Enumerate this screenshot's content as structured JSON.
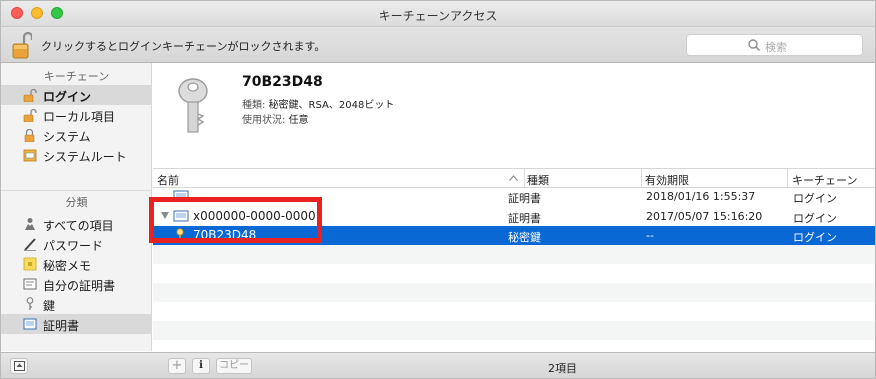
{
  "window": {
    "title": "キーチェーンアクセス"
  },
  "toolbar": {
    "lock_text": "クリックするとログインキーチェーンがロックされます。",
    "search_placeholder": "検索"
  },
  "sidebar": {
    "keychains_heading": "キーチェーン",
    "keychains": [
      {
        "label": "ログイン",
        "icon": "padlock-open-icon",
        "selected": true
      },
      {
        "label": "ローカル項目",
        "icon": "padlock-open-icon",
        "selected": false
      },
      {
        "label": "システム",
        "icon": "padlock-closed-icon",
        "selected": false
      },
      {
        "label": "システムルート",
        "icon": "certificate-folder-icon",
        "selected": false
      }
    ],
    "category_heading": "分類",
    "categories": [
      {
        "label": "すべての項目",
        "icon": "people-icon",
        "selected": false
      },
      {
        "label": "パスワード",
        "icon": "pencil-icon",
        "selected": false
      },
      {
        "label": "秘密メモ",
        "icon": "note-icon",
        "selected": false
      },
      {
        "label": "自分の証明書",
        "icon": "my-certificate-icon",
        "selected": false
      },
      {
        "label": "鍵",
        "icon": "key-icon",
        "selected": false
      },
      {
        "label": "証明書",
        "icon": "certificate-icon",
        "selected": true
      }
    ]
  },
  "detail": {
    "name": "70B23D48",
    "kind_label": "種類:",
    "kind_value": "秘密鍵、RSA、2048ビット",
    "usage_label": "使用状況:",
    "usage_value": "任意"
  },
  "table": {
    "columns": [
      "名前",
      "種類",
      "有効期限",
      "キーチェーン"
    ],
    "rows": [
      {
        "name": "...",
        "kind": "証明書",
        "expires": "2018/01/16 1:55:37",
        "keychain": "ログイン",
        "partially_hidden": true
      },
      {
        "name": "x000000-0000-0000",
        "kind": "証明書",
        "expires": "2017/05/07 15:16:20",
        "keychain": "ログイン",
        "expanded": true
      },
      {
        "name": "70B23D48",
        "kind": "秘密鍵",
        "expires": "--",
        "keychain": "ログイン",
        "selected": true
      }
    ]
  },
  "status": {
    "count": "2項目",
    "add_label": "+",
    "info_label": "i",
    "copy_label": "コピー"
  },
  "colors": {
    "selection": "#0a68d5",
    "highlight_box": "#ea2121"
  }
}
